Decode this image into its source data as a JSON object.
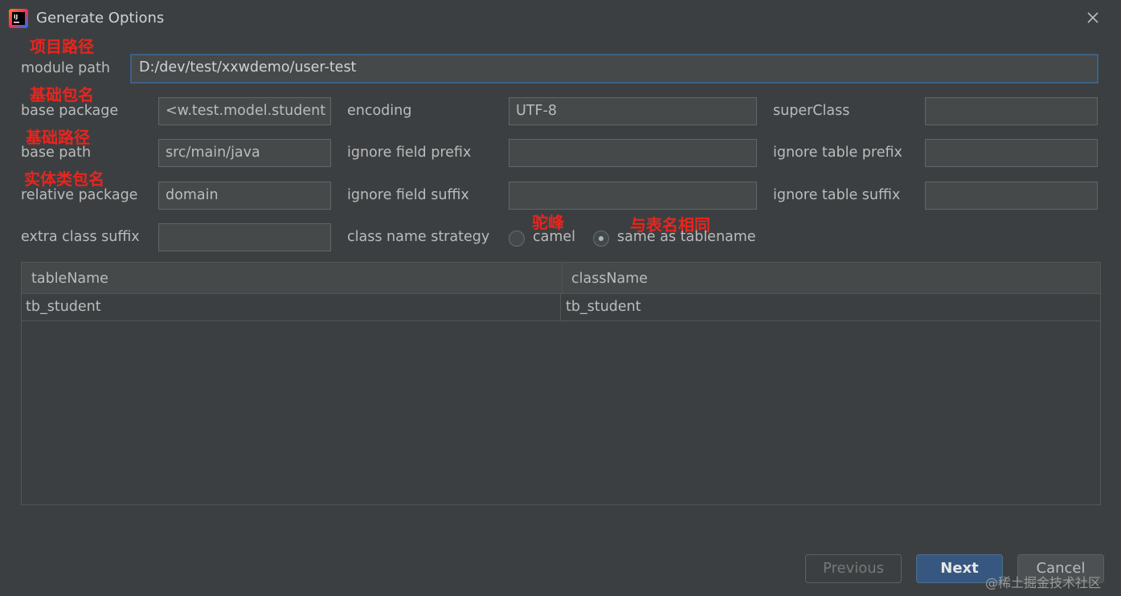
{
  "window": {
    "title": "Generate Options",
    "app_icon": "intellij-idea-icon",
    "close_icon": "close-icon"
  },
  "annotations": {
    "module_path": "项目路径",
    "base_package": "基础包名",
    "base_path": "基础路径",
    "relative_package": "实体类包名",
    "camel": "驼峰",
    "same_as_table": "与表名相同"
  },
  "form": {
    "module_path": {
      "label": "module path",
      "value": "D:/dev/test/xxwdemo/user-test"
    },
    "base_package": {
      "label": "base package",
      "value": "<w.test.model.student"
    },
    "base_path": {
      "label": "base path",
      "value": "src/main/java"
    },
    "relative_package": {
      "label": "relative package",
      "value": "domain"
    },
    "extra_class_suffix": {
      "label": "extra class suffix",
      "value": ""
    },
    "encoding": {
      "label": "encoding",
      "value": "UTF-8"
    },
    "ignore_field_prefix": {
      "label": "ignore field prefix",
      "value": ""
    },
    "ignore_field_suffix": {
      "label": "ignore field suffix",
      "value": ""
    },
    "class_name_strategy": {
      "label": "class name strategy",
      "options": [
        "camel",
        "same as tablename"
      ],
      "selected": "same as tablename"
    },
    "superclass": {
      "label": "superClass",
      "value": ""
    },
    "ignore_table_prefix": {
      "label": "ignore table prefix",
      "value": ""
    },
    "ignore_table_suffix": {
      "label": "ignore table suffix",
      "value": ""
    }
  },
  "table": {
    "columns": [
      "tableName",
      "className"
    ],
    "rows": [
      [
        "tb_student",
        "tb_student"
      ]
    ]
  },
  "buttons": {
    "previous": "Previous",
    "next": "Next",
    "cancel": "Cancel"
  },
  "watermark": "@稀土掘金技术社区",
  "colors": {
    "background": "#3c3f41",
    "field_bg": "#45494a",
    "accent": "#365880",
    "annotation": "#e8251e"
  }
}
